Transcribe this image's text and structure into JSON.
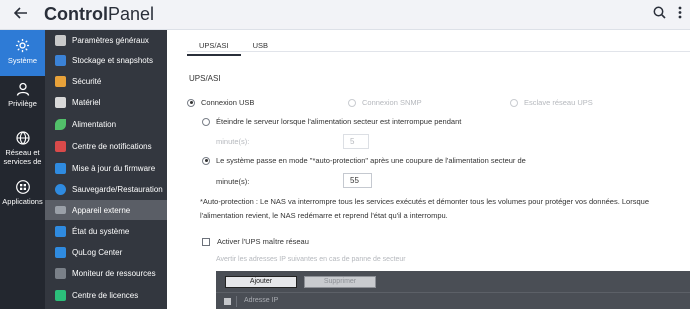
{
  "header": {
    "title_bold": "Control",
    "title_rest": "Panel",
    "icons": [
      "back-arrow-icon",
      "search-icon",
      "more-vertical-icon"
    ]
  },
  "rail": {
    "items": [
      {
        "label": "Système",
        "icon": "gear-icon",
        "active": true
      },
      {
        "label": "Privilège",
        "icon": "user-icon",
        "active": false
      },
      {
        "label": "Réseau et services de",
        "icon": "globe-icon",
        "active": false
      },
      {
        "label": "Applications",
        "icon": "apps-grid-icon",
        "active": false
      }
    ]
  },
  "menu": {
    "items": [
      {
        "label": "Paramètres généraux",
        "color": "#c9c9c9"
      },
      {
        "label": "Stockage et snapshots",
        "color": "#3b82d6"
      },
      {
        "label": "Sécurité",
        "color": "#e8a23a"
      },
      {
        "label": "Matériel",
        "color": "#d9d9d9"
      },
      {
        "label": "Alimentation",
        "color": "#52c06a"
      },
      {
        "label": "Centre de notifications",
        "color": "#d94a4a"
      },
      {
        "label": "Mise à jour du firmware",
        "color": "#2f8be0"
      },
      {
        "label": "Sauvegarde/Restauration",
        "color": "#2f8be0"
      },
      {
        "label": "Appareil externe",
        "color": "#9aa0a8",
        "active": true
      },
      {
        "label": "État du système",
        "color": "#2f8be0"
      },
      {
        "label": "QuLog Center",
        "color": "#2f8be0"
      },
      {
        "label": "Moniteur de ressources",
        "color": "#7a8088"
      },
      {
        "label": "Centre de licences",
        "color": "#2bbf7a"
      }
    ]
  },
  "tabs": [
    {
      "label": "UPS/ASI",
      "active": true
    },
    {
      "label": "USB",
      "active": false
    }
  ],
  "main": {
    "section_title": "UPS/ASI",
    "connection_options": [
      "Connexion USB",
      "Connexion SNMP",
      "Esclave réseau UPS"
    ],
    "option_shutdown": "Éteindre le serveur lorsque l'alimentation secteur est interrompue pendant",
    "minutes_label_1": "minute(s):",
    "minutes_value_1": "5",
    "option_autoprotect": "Le système passe en mode \"*auto-protection\" après une coupure de l'alimentation secteur de",
    "minutes_label_2": "minute(s):",
    "minutes_value_2": "55",
    "note_line1": "*Auto-protection : Le NAS va interrompre tous les services exécutés et démonter tous les volumes pour protéger vos données. Lorsque",
    "note_line2": "l'alimentation revient, le NAS redémarre et reprend l'état qu'il a interrompu.",
    "network_master_label": "Activer l'UPS maître réseau",
    "notify_hint": "Avertir les adresses IP suivantes en cas de panne de secteur",
    "add_button": "Ajouter",
    "delete_button": "Supprimer",
    "ip_column": "Adresse IP"
  }
}
